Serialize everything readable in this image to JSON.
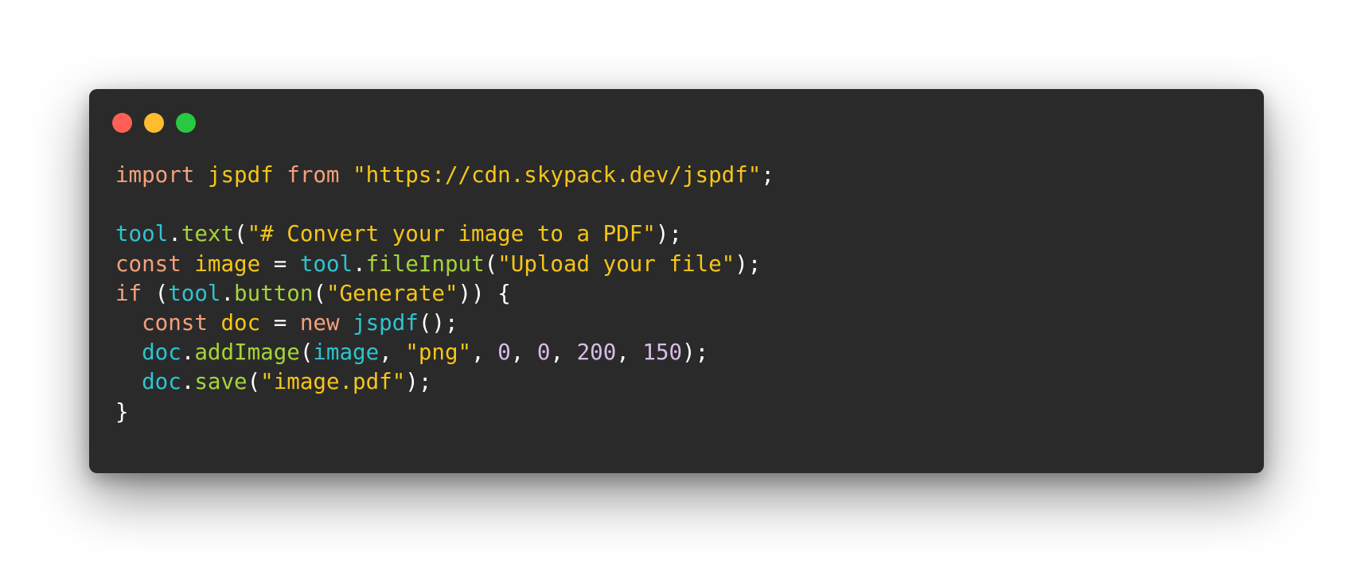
{
  "window": {
    "controls": [
      {
        "name": "close",
        "color": "#fe5f57"
      },
      {
        "name": "minimize",
        "color": "#febc2e"
      },
      {
        "name": "maximize",
        "color": "#28c840"
      }
    ]
  },
  "colors": {
    "keyword": "#f4a07c",
    "identifier": "#f5c518",
    "string": "#f5c518",
    "object": "#2ec4cf",
    "function": "#a6d33a",
    "number": "#d8bde8",
    "punctuation": "#ffffff",
    "background": "#2a2a2a"
  },
  "code": {
    "lines": [
      [
        {
          "t": "kw",
          "v": "import"
        },
        {
          "t": "pun",
          "v": " "
        },
        {
          "t": "id",
          "v": "jspdf"
        },
        {
          "t": "pun",
          "v": " "
        },
        {
          "t": "kw",
          "v": "from"
        },
        {
          "t": "pun",
          "v": " "
        },
        {
          "t": "str",
          "v": "\"https://cdn.skypack.dev/jspdf\""
        },
        {
          "t": "pun",
          "v": ";"
        }
      ],
      [],
      [
        {
          "t": "obj",
          "v": "tool"
        },
        {
          "t": "pun",
          "v": "."
        },
        {
          "t": "fn",
          "v": "text"
        },
        {
          "t": "pun",
          "v": "("
        },
        {
          "t": "str",
          "v": "\"# Convert your image to a PDF\""
        },
        {
          "t": "pun",
          "v": ");"
        }
      ],
      [
        {
          "t": "kw",
          "v": "const"
        },
        {
          "t": "pun",
          "v": " "
        },
        {
          "t": "id",
          "v": "image"
        },
        {
          "t": "pun",
          "v": " = "
        },
        {
          "t": "obj",
          "v": "tool"
        },
        {
          "t": "pun",
          "v": "."
        },
        {
          "t": "fn",
          "v": "fileInput"
        },
        {
          "t": "pun",
          "v": "("
        },
        {
          "t": "str",
          "v": "\"Upload your file\""
        },
        {
          "t": "pun",
          "v": ");"
        }
      ],
      [
        {
          "t": "kw",
          "v": "if"
        },
        {
          "t": "pun",
          "v": " ("
        },
        {
          "t": "obj",
          "v": "tool"
        },
        {
          "t": "pun",
          "v": "."
        },
        {
          "t": "fn",
          "v": "button"
        },
        {
          "t": "pun",
          "v": "("
        },
        {
          "t": "str",
          "v": "\"Generate\""
        },
        {
          "t": "pun",
          "v": ")) {"
        }
      ],
      [
        {
          "t": "pun",
          "v": "  "
        },
        {
          "t": "kw",
          "v": "const"
        },
        {
          "t": "pun",
          "v": " "
        },
        {
          "t": "id",
          "v": "doc"
        },
        {
          "t": "pun",
          "v": " = "
        },
        {
          "t": "kw",
          "v": "new"
        },
        {
          "t": "pun",
          "v": " "
        },
        {
          "t": "obj",
          "v": "jspdf"
        },
        {
          "t": "pun",
          "v": "();"
        }
      ],
      [
        {
          "t": "pun",
          "v": "  "
        },
        {
          "t": "obj",
          "v": "doc"
        },
        {
          "t": "pun",
          "v": "."
        },
        {
          "t": "fn",
          "v": "addImage"
        },
        {
          "t": "pun",
          "v": "("
        },
        {
          "t": "obj",
          "v": "image"
        },
        {
          "t": "pun",
          "v": ", "
        },
        {
          "t": "str",
          "v": "\"png\""
        },
        {
          "t": "pun",
          "v": ", "
        },
        {
          "t": "num",
          "v": "0"
        },
        {
          "t": "pun",
          "v": ", "
        },
        {
          "t": "num",
          "v": "0"
        },
        {
          "t": "pun",
          "v": ", "
        },
        {
          "t": "num",
          "v": "200"
        },
        {
          "t": "pun",
          "v": ", "
        },
        {
          "t": "num",
          "v": "150"
        },
        {
          "t": "pun",
          "v": ");"
        }
      ],
      [
        {
          "t": "pun",
          "v": "  "
        },
        {
          "t": "obj",
          "v": "doc"
        },
        {
          "t": "pun",
          "v": "."
        },
        {
          "t": "fn",
          "v": "save"
        },
        {
          "t": "pun",
          "v": "("
        },
        {
          "t": "str",
          "v": "\"image.pdf\""
        },
        {
          "t": "pun",
          "v": ");"
        }
      ],
      [
        {
          "t": "pun",
          "v": "}"
        }
      ]
    ]
  }
}
